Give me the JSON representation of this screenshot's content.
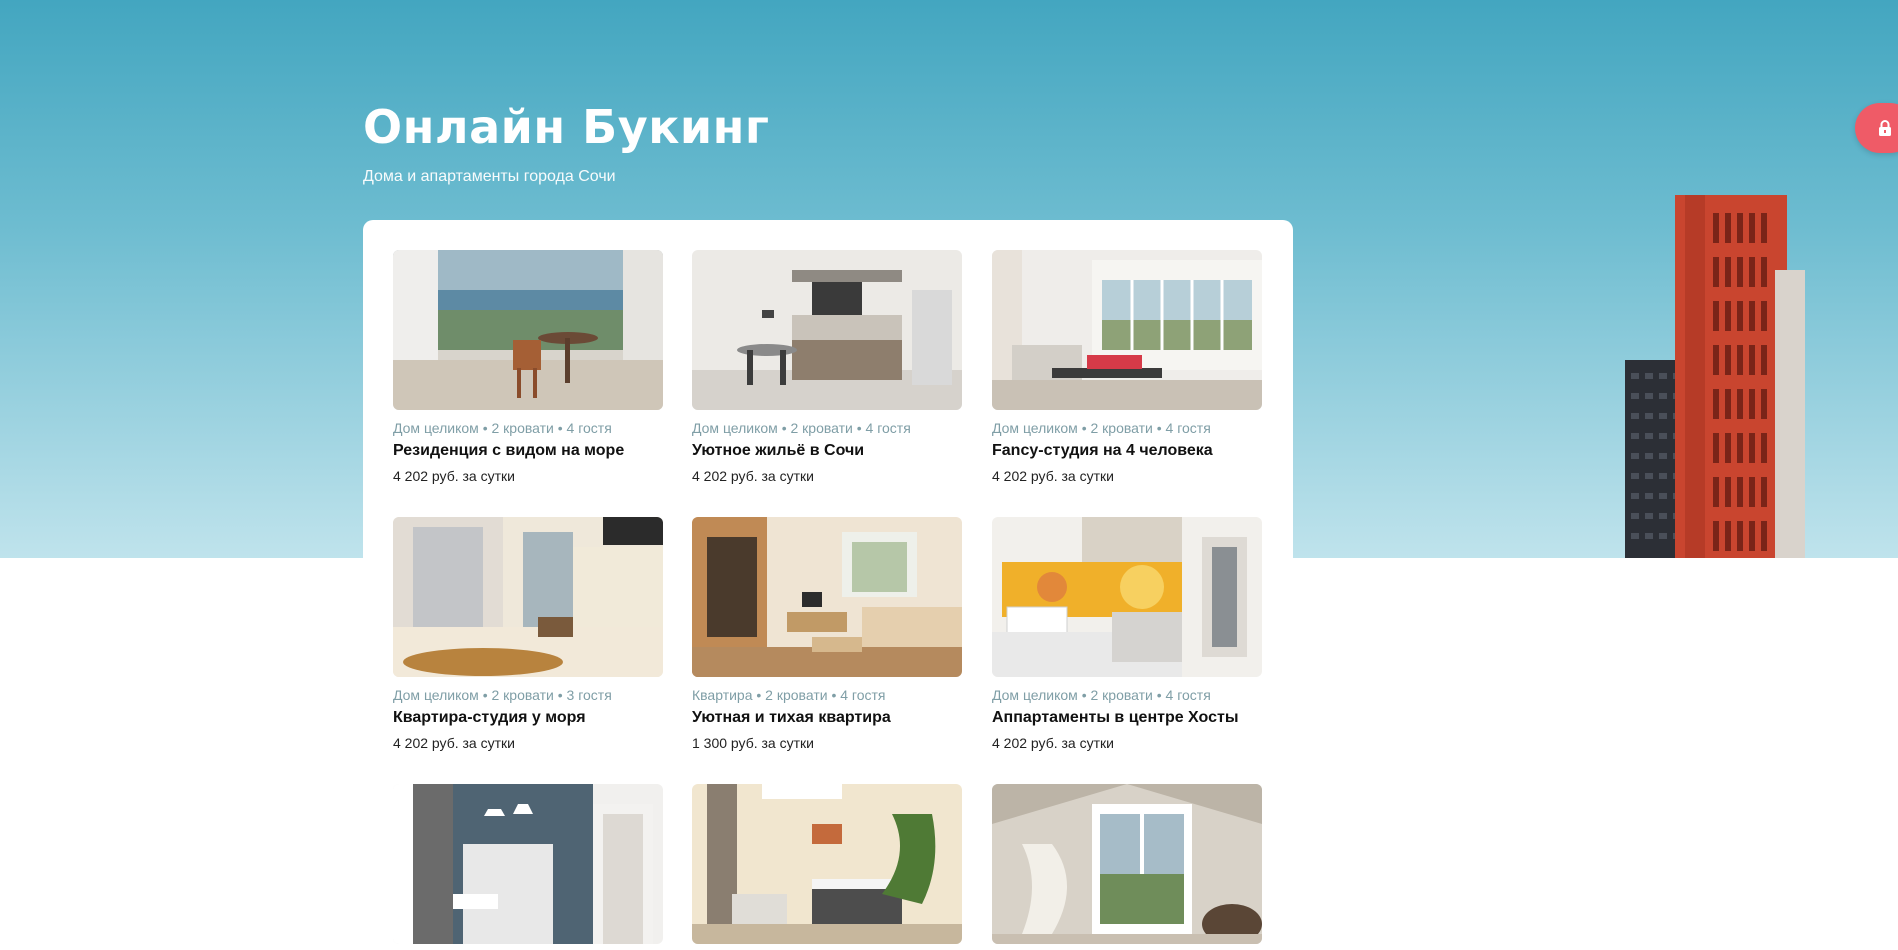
{
  "header": {
    "title": "Онлайн Букинг",
    "subtitle": "Дома и апартаменты города Сочи"
  },
  "colors": {
    "hero_top": "#43a6c0",
    "hero_bottom": "#bfe3ec",
    "lock_button": "#ef5b67",
    "meta_text": "#7f9ea6"
  },
  "lock_button": {
    "icon": "lock-icon"
  },
  "listings": [
    {
      "meta": "Дом целиком • 2 кровати • 4 гостя",
      "title": "Резиденция с видом на море",
      "price": "4 202 руб. за сутки"
    },
    {
      "meta": "Дом целиком • 2 кровати • 4 гостя",
      "title": "Уютное жильё в Сочи",
      "price": "4 202 руб. за сутки"
    },
    {
      "meta": "Дом целиком • 2 кровати • 4 гостя",
      "title": "Fancy-студия на 4 человека",
      "price": "4 202 руб. за сутки"
    },
    {
      "meta": "Дом целиком • 2 кровати • 3 гостя",
      "title": "Квартира-студия у моря",
      "price": "4 202 руб. за сутки"
    },
    {
      "meta": "Квартира • 2 кровати • 4 гостя",
      "title": "Уютная и тихая квартира",
      "price": "1 300 руб. за сутки"
    },
    {
      "meta": "Дом целиком • 2 кровати • 4 гостя",
      "title": "Аппартаменты в центре Хосты",
      "price": "4 202 руб. за сутки"
    }
  ]
}
